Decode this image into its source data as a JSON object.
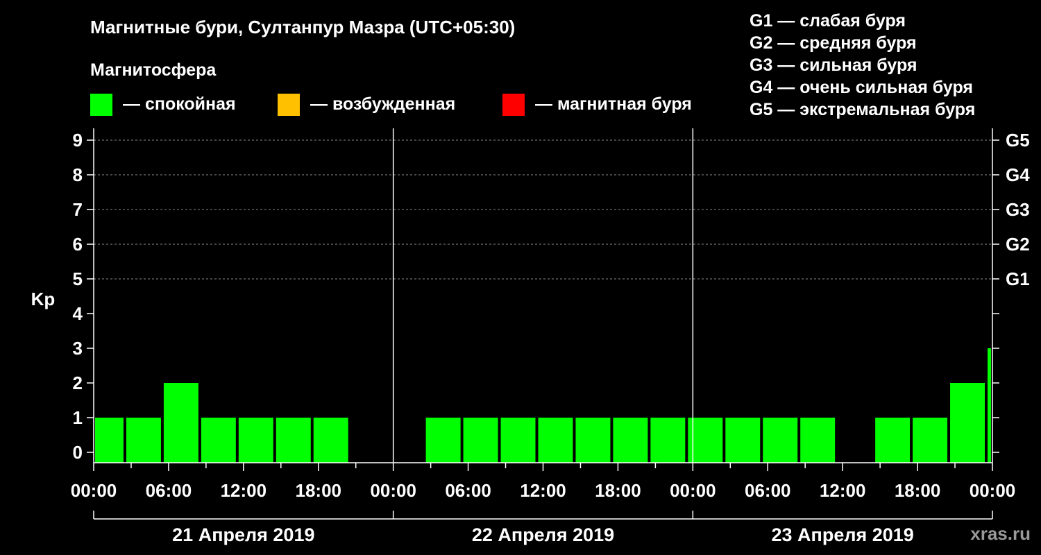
{
  "title": "Магнитные бури, Султанпур Мазра (UTC+05:30)",
  "legend": {
    "heading": "Магнитосфера",
    "items": [
      {
        "label": "— спокойная",
        "color": "#00ff00"
      },
      {
        "label": "— возбужденная",
        "color": "#ffc000"
      },
      {
        "label": "— магнитная буря",
        "color": "#ff0000"
      }
    ]
  },
  "storm_scale": [
    "G1 — слабая буря",
    "G2 — средняя буря",
    "G3 — сильная буря",
    "G4 — очень сильная буря",
    "G5 — экстремальная буря"
  ],
  "brand": "xras.ru",
  "chart_data": {
    "type": "bar",
    "ylabel": "Kp",
    "ylim": [
      0,
      9
    ],
    "yticks": [
      0,
      1,
      2,
      3,
      4,
      5,
      6,
      7,
      8,
      9
    ],
    "right_axis_labels": [
      {
        "kp": 5,
        "label": "G1"
      },
      {
        "kp": 6,
        "label": "G2"
      },
      {
        "kp": 7,
        "label": "G3"
      },
      {
        "kp": 8,
        "label": "G4"
      },
      {
        "kp": 9,
        "label": "G5"
      }
    ],
    "x_tick_labels": [
      "00:00",
      "06:00",
      "12:00",
      "18:00",
      "00:00",
      "06:00",
      "12:00",
      "18:00",
      "00:00",
      "06:00",
      "12:00",
      "18:00",
      "00:00"
    ],
    "days": [
      "21 Апреля 2019",
      "22 Апреля 2019",
      "23 Апреля 2019"
    ],
    "grid": true,
    "bars": [
      {
        "start": "2019-04-21 00:00",
        "end": "2019-04-21 02:30",
        "kp": 1
      },
      {
        "start": "2019-04-21 02:30",
        "end": "2019-04-21 05:30",
        "kp": 1
      },
      {
        "start": "2019-04-21 05:30",
        "end": "2019-04-21 08:30",
        "kp": 2
      },
      {
        "start": "2019-04-21 08:30",
        "end": "2019-04-21 11:30",
        "kp": 1
      },
      {
        "start": "2019-04-21 11:30",
        "end": "2019-04-21 14:30",
        "kp": 1
      },
      {
        "start": "2019-04-21 14:30",
        "end": "2019-04-21 17:30",
        "kp": 1
      },
      {
        "start": "2019-04-21 17:30",
        "end": "2019-04-21 20:30",
        "kp": 1
      },
      {
        "start": "2019-04-22 02:30",
        "end": "2019-04-22 05:30",
        "kp": 1
      },
      {
        "start": "2019-04-22 05:30",
        "end": "2019-04-22 08:30",
        "kp": 1
      },
      {
        "start": "2019-04-22 08:30",
        "end": "2019-04-22 11:30",
        "kp": 1
      },
      {
        "start": "2019-04-22 11:30",
        "end": "2019-04-22 14:30",
        "kp": 1
      },
      {
        "start": "2019-04-22 14:30",
        "end": "2019-04-22 17:30",
        "kp": 1
      },
      {
        "start": "2019-04-22 17:30",
        "end": "2019-04-22 20:30",
        "kp": 1
      },
      {
        "start": "2019-04-22 20:30",
        "end": "2019-04-22 23:30",
        "kp": 1
      },
      {
        "start": "2019-04-22 23:30",
        "end": "2019-04-23 02:30",
        "kp": 1
      },
      {
        "start": "2019-04-23 02:30",
        "end": "2019-04-23 05:30",
        "kp": 1
      },
      {
        "start": "2019-04-23 05:30",
        "end": "2019-04-23 08:30",
        "kp": 1
      },
      {
        "start": "2019-04-23 08:30",
        "end": "2019-04-23 11:30",
        "kp": 1
      },
      {
        "start": "2019-04-23 14:30",
        "end": "2019-04-23 17:30",
        "kp": 1
      },
      {
        "start": "2019-04-23 17:30",
        "end": "2019-04-23 20:30",
        "kp": 1
      },
      {
        "start": "2019-04-23 20:30",
        "end": "2019-04-23 23:30",
        "kp": 2
      },
      {
        "start": "2019-04-23 23:30",
        "end": "2019-04-24 00:00",
        "kp": 3
      }
    ]
  }
}
